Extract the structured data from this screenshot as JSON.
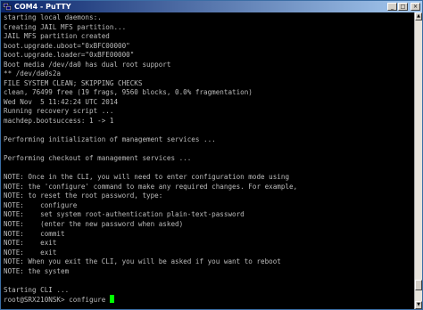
{
  "window": {
    "title": "COM4 - PuTTY",
    "minimize_glyph": "_",
    "maximize_glyph": "□",
    "close_glyph": "×"
  },
  "scrollbar": {
    "up_glyph": "▲",
    "down_glyph": "▼",
    "thumb_position": 0.96
  },
  "terminal": {
    "lines": [
      "starting local daemons:.",
      "Creating JAIL MFS partition...",
      "JAIL MFS partition created",
      "boot.upgrade.uboot=\"0xBFC00000\"",
      "boot.upgrade.loader=\"0xBFE00000\"",
      "Boot media /dev/da0 has dual root support",
      "** /dev/da0s2a",
      "FILE SYSTEM CLEAN; SKIPPING CHECKS",
      "clean, 76499 free (19 frags, 9560 blocks, 0.0% fragmentation)",
      "Wed Nov  5 11:42:24 UTC 2014",
      "Running recovery script ...",
      "machdep.bootsuccess: 1 -> 1",
      "",
      "Performing initialization of management services ...",
      "",
      "Performing checkout of management services ...",
      "",
      "NOTE: Once in the CLI, you will need to enter configuration mode using",
      "NOTE: the 'configure' command to make any required changes. For example,",
      "NOTE: to reset the root password, type:",
      "NOTE:    configure",
      "NOTE:    set system root-authentication plain-text-password",
      "NOTE:    (enter the new password when asked)",
      "NOTE:    commit",
      "NOTE:    exit",
      "NOTE:    exit",
      "NOTE: When you exit the CLI, you will be asked if you want to reboot",
      "NOTE: the system",
      "",
      "Starting CLI ..."
    ],
    "prompt": "root@SRX210NSK> configure ",
    "colors": {
      "background": "#000000",
      "text": "#bbbbbb",
      "cursor": "#00ff00"
    }
  }
}
